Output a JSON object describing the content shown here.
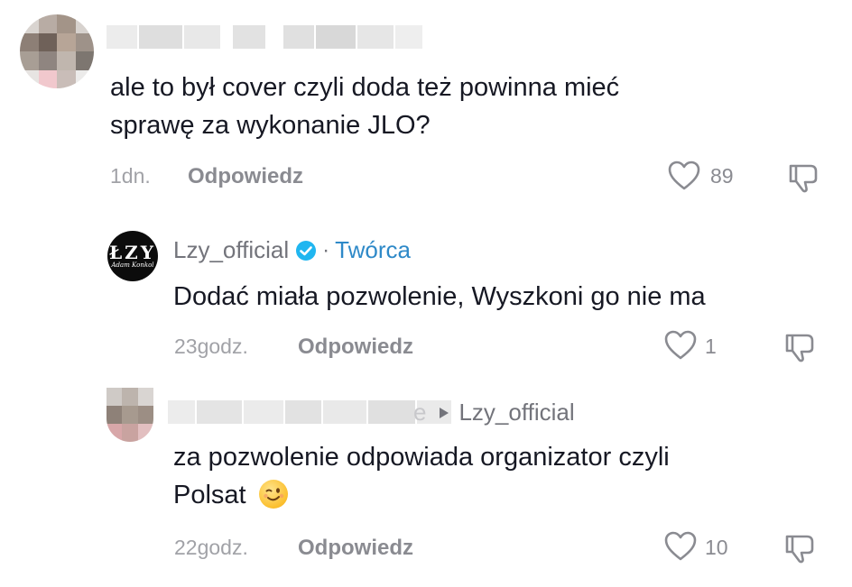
{
  "comments": [
    {
      "text_line1": "ale to był cover czyli doda też powinna mieć",
      "text_line2": "sprawę za wykonanie JLO?",
      "time": "1dn.",
      "reply_label": "Odpowiedz",
      "likes": "89"
    },
    {
      "author": "Lzy_official",
      "separator": "·",
      "creator_tag": "Twórca",
      "logo_text": "ŁZY",
      "logo_sub": "Adam Konkol",
      "text": "Dodać miała pozwolenie, Wyszkoni go nie ma",
      "time": "23godz.",
      "reply_label": "Odpowiedz",
      "likes": "1"
    },
    {
      "name_suffix": "e",
      "reply_to": "Lzy_official",
      "text_line1": "za pozwolenie odpowiada organizator czyli",
      "text_line2": "Polsat",
      "time": "22godz.",
      "reply_label": "Odpowiedz",
      "likes": "10"
    }
  ],
  "colors": {
    "creator_tag": "#2e89c8",
    "verified_badge": "#20b6f0",
    "meta_gray": "#a1a2a7"
  },
  "icons": [
    "heart-outline-icon",
    "thumbs-down-icon",
    "verified-check-icon",
    "play-arrow-icon",
    "wink-emoji"
  ]
}
